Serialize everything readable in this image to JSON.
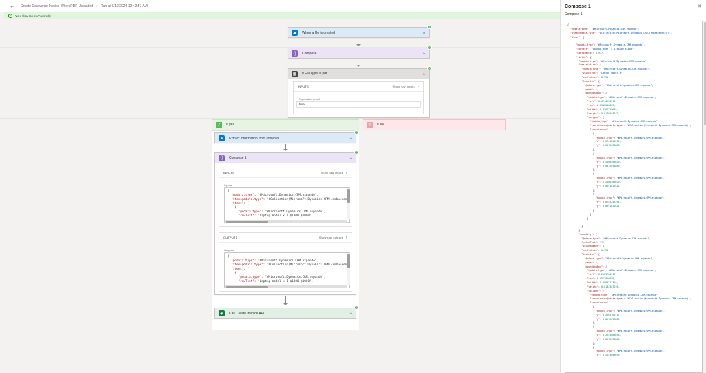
{
  "topbar": {
    "back_icon": "arrow-left-icon",
    "flow_name": "Create Dataverse Invoice When PDF Uploaded",
    "separator": ">",
    "run_label": "Run at 5/12/2024 12:42:57 AM"
  },
  "banner": {
    "icon": "check-circle-icon",
    "message": "Your flow ran successfully."
  },
  "steps": {
    "trigger": {
      "title": "When a file is created",
      "duration": "0s",
      "icon": "cloud-icon",
      "color": "#0078d4",
      "accent": "#dce9f6"
    },
    "compose": {
      "title": "Compose",
      "duration": "0s",
      "icon": "braces-icon",
      "color": "#8661c5",
      "accent": "#ebe4f7"
    },
    "condition": {
      "title": "If FileType is pdf",
      "duration": "0s",
      "icon": "condition-icon",
      "color": "#484644",
      "inputs_label": "INPUTS",
      "show_raw_inputs": "Show raw inputs",
      "expr_label": "Expression result",
      "expr_value": "true"
    },
    "if_yes": {
      "label": "If yes",
      "color": "#5cb85c",
      "accent": "#e7f3e3"
    },
    "if_no": {
      "label": "If no",
      "color": "#e8a3a3",
      "accent": "#fde7e9"
    },
    "extract": {
      "title": "Extract information from invoices",
      "duration": "0s",
      "icon": "ai-builder-icon",
      "color": "#0078d4",
      "accent": "#dce9f6"
    },
    "compose1": {
      "title": "Compose 1",
      "duration": "0s",
      "icon": "braces-icon",
      "color": "#8661c5",
      "accent": "#ebe4f7",
      "inputs_label": "INPUTS",
      "show_raw_inputs": "Show raw inputs",
      "inputs_field": "Inputs",
      "outputs_label": "OUTPUTS",
      "show_raw_outputs": "Show raw outputs",
      "outputs_field": "Outputs",
      "code_lines": [
        "{",
        "  \"@odata.type\": \"#Microsoft.Dynamics.CRM.expando\",",
        "  \"items@odata.type\": \"#Collection(Microsoft.Dynamics.CRM.crmbaseentit",
        "  \"items\": [",
        "    {",
        "      \"@odata.type\": \"#Microsoft.Dynamics.CRM.expando\",",
        "      \"rowText\": \"Laptop model x 1 $1000 $1000\","
      ]
    },
    "call_api": {
      "title": "Call Create Invoice API",
      "duration": "0s",
      "icon": "dataverse-icon",
      "color": "#107c41",
      "accent": "#e2efe6"
    }
  },
  "panel": {
    "title": "Compose 1",
    "subtitle": "Compose 1",
    "close_icon": "close-icon",
    "json_lines": [
      "{",
      "  \"@odata.type\": \"#Microsoft.Dynamics.CRM.expando\",",
      "  \"items@odata.type\": \"#Collection(Microsoft.Dynamics.CRM.crmbaseentity)\",",
      "  \"items\": [",
      "    {",
      "      \"@odata.type\": \"#Microsoft.Dynamics.CRM.expando\",",
      "      \"rowText\": \"Laptop model x 1 $1000 $1000\",",
      "      \"confidence\": 0.937,",
      "      \"fields\": {",
      "        \"@odata.type\": \"#Microsoft.Dynamics.CRM.expando\",",
      "        \"description\": {",
      "          \"@odata.type\": \"#Microsoft.Dynamics.CRM.expando\",",
      "          \"valueText\": \"Laptop model x\",",
      "          \"confidence\": 0.951,",
      "          \"location\": {",
      "            \"@odata.type\": \"#Microsoft.Dynamics.CRM.expando\",",
      "            \"page\": 1,",
      "            \"boundingBox\": {",
      "              \"@odata.type\": \"#Microsoft.Dynamics.CRM.expando\",",
      "              \"left\": 0.0744253394,",
      "              \"top\": 0.0512056889,",
      "              \"width\": 0.1362329635,",
      "              \"height\": 0.0179563632,",
      "              \"polygon\": {",
      "                \"@odata.type\": \"#Microsoft.Dynamics.CRM.expando\",",
      "                \"coordinates@odata.type\": \"#Collection(Microsoft.Dynamics.CRM.expando)\",",
      "                \"coordinates\": [",
      "                  {",
      "                    \"@odata.type\": \"#Microsoft.Dynamics.CRM.expando\",",
      "                    \"x\": 0.0744253394,",
      "                    \"y\": 0.0512056889",
      "                  },",
      "                  {",
      "                    \"@odata.type\": \"#Microsoft.Dynamics.CRM.expando\",",
      "                    \"x\": 0.2106583029,",
      "                    \"y\": 0.0512056889",
      "                  },",
      "                  {",
      "                    \"@odata.type\": \"#Microsoft.Dynamics.CRM.expando\",",
      "                    \"x\": 0.2106583029,",
      "                    \"y\": 0.0691620521",
      "                  },",
      "                  {",
      "                    \"@odata.type\": \"#Microsoft.Dynamics.CRM.expando\",",
      "                    \"x\": 0.0744253394,",
      "                    \"y\": 0.0691620521",
      "                  }",
      "                ]",
      "              }",
      "            }",
      "          }",
      "        },",
      "        \"quantity\": {",
      "          \"@odata.type\": \"#Microsoft.Dynamics.CRM.expando\",",
      "          \"valueText\": \"1\",",
      "          \"valueNumber\": 1,",
      "          \"confidence\": 0.951,",
      "          \"location\": {",
      "            \"@odata.type\": \"#Microsoft.Dynamics.CRM.expando\",",
      "            \"page\": 1,",
      "            \"boundingBox\": {",
      "              \"@odata.type\": \"#Microsoft.Dynamics.CRM.expando\",",
      "              \"left\": 0.2563760717,",
      "              \"top\": 0.0512056889,",
      "              \"width\": 0.0089322316,",
      "              \"height\": 0.0134387016,",
      "              \"polygon\": {",
      "                \"@odata.type\": \"#Microsoft.Dynamics.CRM.expando\",",
      "                \"coordinates@odata.type\": \"#Collection(Microsoft.Dynamics.CRM.expando)\",",
      "                \"coordinates\": [",
      "                  {",
      "                    \"@odata.type\": \"#Microsoft.Dynamics.CRM.expando\",",
      "                    \"x\": 0.2563760717,",
      "                    \"y\": 0.0512056889",
      "                  },",
      "                  {",
      "                    \"@odata.type\": \"#Microsoft.Dynamics.CRM.expando\",",
      "                    \"x\": 0.2653083033,",
      "                    \"y\": 0.0512056889",
      "                  },",
      "                  {",
      "                    \"@odata.type\": \"#Microsoft.Dynamics.CRM.expando\",",
      "                    \"x\": 0.2653083033"
    ]
  }
}
